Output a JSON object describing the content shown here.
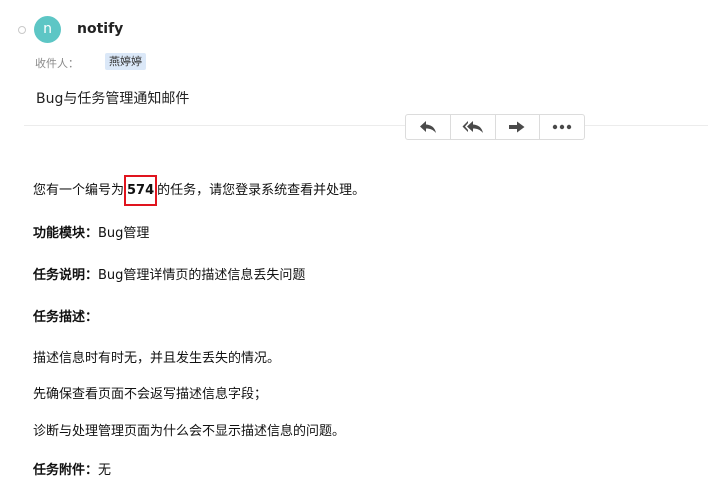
{
  "header": {
    "avatar_letter": "n",
    "sender": "notify",
    "recipient_label": "收件人：",
    "recipient": "燕婷婷",
    "subject": "Bug与任务管理通知邮件"
  },
  "toolbar": {
    "buttons": [
      {
        "icon": "reply-icon"
      },
      {
        "icon": "reply-all-icon"
      },
      {
        "icon": "forward-icon"
      },
      {
        "icon": "more-icon"
      }
    ]
  },
  "body": {
    "intro_prefix": "您有一个编号为",
    "task_number": "574",
    "intro_suffix": "的任务，请您登录系统查看并处理。",
    "module_label": "功能模块：",
    "module_value": "Bug管理",
    "desc_label": "任务说明：",
    "desc_value": "Bug管理详情页的描述信息丢失问题",
    "detail_label": "任务描述：",
    "detail_lines": [
      "描述信息时有时无，并且发生丢失的情况。",
      "先确保查看页面不会返写描述信息字段；",
      "诊断与处理管理页面为什么会不显示描述信息的问题。"
    ],
    "attach_label": "任务附件：",
    "attach_value": "无"
  },
  "colors": {
    "avatar": "#5dc6c5",
    "recipient_chip": "#dbe8f8",
    "highlight_box": "#e0141e"
  }
}
